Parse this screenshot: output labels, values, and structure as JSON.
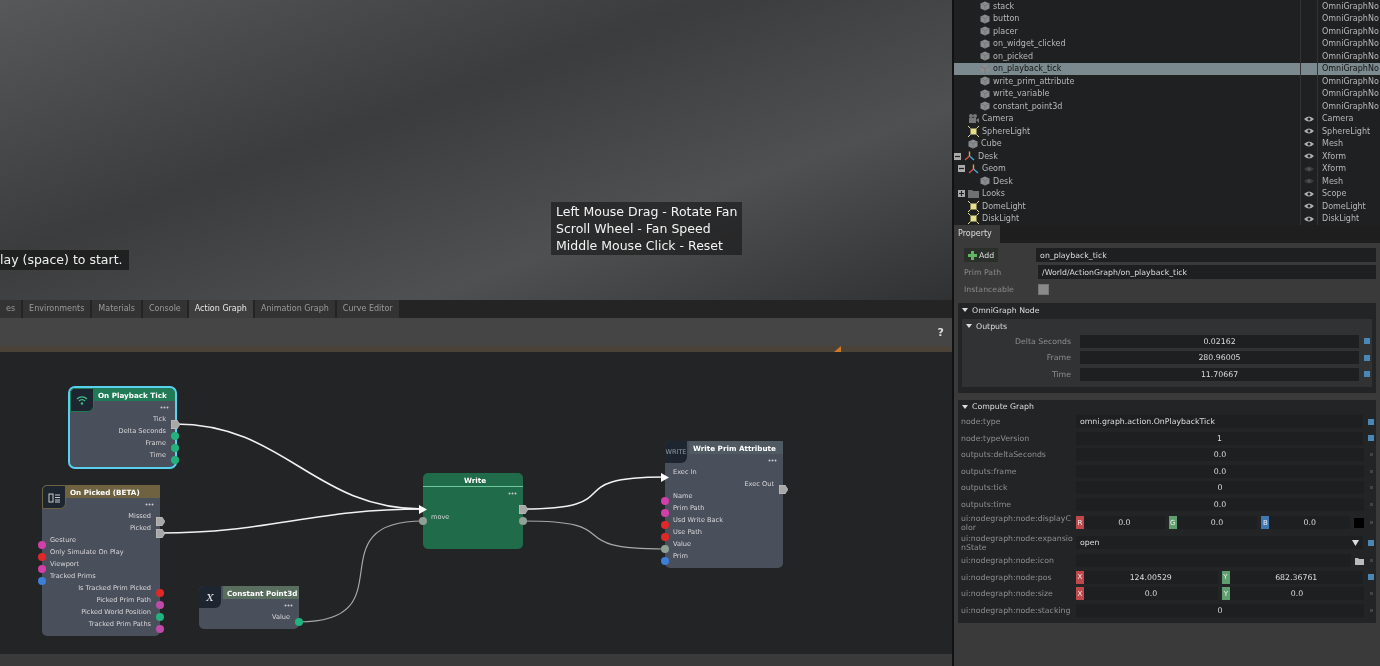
{
  "viewport": {
    "hint": "lay (space) to start.",
    "help": [
      "Left Mouse Drag - Rotate Fan",
      "Scroll Wheel - Fan Speed",
      "Middle Mouse Click - Reset"
    ]
  },
  "tabs": [
    {
      "label": "es",
      "selected": false
    },
    {
      "label": "Environments",
      "selected": false
    },
    {
      "label": "Materials",
      "selected": false
    },
    {
      "label": "Console",
      "selected": false
    },
    {
      "label": "Action Graph",
      "selected": true
    },
    {
      "label": "Animation Graph",
      "selected": false
    },
    {
      "label": "Curve Editor",
      "selected": false
    }
  ],
  "graph": {
    "help": "?",
    "nodes": [
      {
        "title": "On Playback Tick",
        "kind": "event",
        "color": "#1f7a55",
        "selected": true,
        "rows": [
          {
            "out": {
              "label": "Tick",
              "kind": "exec"
            }
          },
          {
            "out": {
              "label": "Delta Seconds",
              "kind": "data",
              "color": "#22b27e"
            }
          },
          {
            "out": {
              "label": "Frame",
              "kind": "data",
              "color": "#22b27e"
            }
          },
          {
            "out": {
              "label": "Time",
              "kind": "data",
              "color": "#22b27e"
            }
          }
        ]
      },
      {
        "title": "On Picked (BETA)",
        "kind": "picker",
        "color": "#6e6240",
        "selected": false,
        "rows": [
          {
            "out": {
              "label": "Missed",
              "kind": "exec"
            }
          },
          {
            "out": {
              "label": "Picked",
              "kind": "exec"
            }
          },
          {
            "in": {
              "label": "Gesture",
              "kind": "data",
              "color": "#d23fa8"
            }
          },
          {
            "in": {
              "label": "Only Simulate On Play",
              "kind": "data",
              "color": "#e02828"
            }
          },
          {
            "in": {
              "label": "Viewport",
              "kind": "data",
              "color": "#d23fa8"
            }
          },
          {
            "in": {
              "label": "Tracked Prims",
              "kind": "data",
              "color": "#3d7fd6"
            }
          },
          {
            "out": {
              "label": "Is Tracked Prim Picked",
              "kind": "data",
              "color": "#e02828"
            }
          },
          {
            "out": {
              "label": "Picked Prim Path",
              "kind": "data",
              "color": "#c04aa8"
            }
          },
          {
            "out": {
              "label": "Picked World Position",
              "kind": "data",
              "color": "#22b27e"
            }
          },
          {
            "out": {
              "label": "Tracked Prim Paths",
              "kind": "data",
              "color": "#c04aa8"
            }
          }
        ]
      },
      {
        "title": "Constant Point3d",
        "kind": "constant",
        "icon_text": "X",
        "color": "#5a6e60",
        "selected": false,
        "rows": [
          {
            "out": {
              "label": "Value",
              "kind": "data",
              "color": "#22b27e"
            }
          }
        ]
      },
      {
        "title": "Write",
        "kind": "compound",
        "color": "#1f6b4a",
        "selected": false,
        "rows": [
          {
            "in": {
              "kind": "exec"
            },
            "out": {
              "kind": "exec"
            }
          },
          {
            "in": {
              "label": "move",
              "kind": "data",
              "color": "#8fa095"
            },
            "out": {
              "kind": "data",
              "color": "#8fa095"
            }
          }
        ]
      },
      {
        "title": "Write Prim Attribute",
        "kind": "action",
        "icon_text": "WRITE",
        "color": "#4f5a62",
        "selected": false,
        "rows": [
          {
            "in": {
              "label": "Exec In",
              "kind": "exec"
            }
          },
          {
            "out": {
              "label": "Exec Out",
              "kind": "exec"
            }
          },
          {
            "in": {
              "label": "Name",
              "kind": "data",
              "color": "#d23fa8"
            }
          },
          {
            "in": {
              "label": "Prim Path",
              "kind": "data",
              "color": "#d23fa8"
            }
          },
          {
            "in": {
              "label": "Usd Write Back",
              "kind": "data",
              "color": "#e02828"
            }
          },
          {
            "in": {
              "label": "Use Path",
              "kind": "data",
              "color": "#e02828"
            }
          },
          {
            "in": {
              "label": "Value",
              "kind": "data",
              "color": "#8fa095"
            }
          },
          {
            "in": {
              "label": "Prim",
              "kind": "data",
              "color": "#3d7fd6"
            }
          }
        ]
      }
    ]
  },
  "stage": {
    "rows": [
      {
        "children": [
          {
            "children": [
              {
                "name": "stack",
                "type": "OmniGraphNo",
                "kind": "node",
                "selected": false
              },
              {
                "name": "button",
                "type": "OmniGraphNo",
                "kind": "node",
                "selected": false
              },
              {
                "name": "placer",
                "type": "OmniGraphNo",
                "kind": "node",
                "selected": false
              },
              {
                "name": "on_widget_clicked",
                "type": "OmniGraphNo",
                "kind": "node",
                "selected": false
              },
              {
                "name": "on_picked",
                "type": "OmniGraphNo",
                "kind": "node",
                "selected": false
              },
              {
                "name": "on_playback_tick",
                "type": "OmniGraphNo",
                "kind": "node",
                "selected": true
              },
              {
                "name": "write_prim_attribute",
                "type": "OmniGraphNo",
                "kind": "node",
                "selected": false
              },
              {
                "name": "write_variable",
                "type": "OmniGraphNo",
                "kind": "node",
                "selected": false
              },
              {
                "name": "constant_point3d",
                "type": "OmniGraphNo",
                "kind": "node",
                "selected": false
              }
            ]
          },
          {
            "name": "Camera",
            "type": "Camera",
            "kind": "camera",
            "visible": true,
            "selected": false
          },
          {
            "name": "SphereLight",
            "type": "SphereLight",
            "kind": "light",
            "visible": true,
            "selected": false
          },
          {
            "name": "Cube",
            "type": "Mesh",
            "kind": "node",
            "visible": true,
            "selected": false
          }
        ]
      },
      {
        "name": "Desk",
        "type": "Xform",
        "kind": "xform",
        "visible": true,
        "expanded": true,
        "selected": false,
        "children": [
          {
            "name": "Geom",
            "type": "Xform",
            "kind": "xform",
            "visible": false,
            "expanded": true,
            "selected": false,
            "children": [
              {
                "name": "Desk",
                "type": "Mesh",
                "kind": "node",
                "visible": false,
                "selected": false
              }
            ]
          },
          {
            "name": "Looks",
            "type": "Scope",
            "kind": "folder",
            "visible": true,
            "expanded": false,
            "selected": false
          },
          {
            "name": "DomeLight",
            "type": "DomeLight",
            "kind": "light",
            "visible": true,
            "selected": false
          },
          {
            "name": "DiskLight",
            "type": "DiskLight",
            "kind": "light",
            "visible": true,
            "selected": false
          }
        ]
      }
    ]
  },
  "property": {
    "tab": "Property",
    "add": "Add",
    "name": "on_playback_tick",
    "prim_path_label": "Prim Path",
    "prim_path": "/World/ActionGraph/on_playback_tick",
    "instanceable_label": "Instanceable",
    "instanceable": false,
    "sections": [
      {
        "title": "OmniGraph Node",
        "expanded": true,
        "groups": [
          {
            "title": "Outputs",
            "expanded": true,
            "rows": [
              {
                "kind": "number",
                "label": "Delta Seconds",
                "value": "0.02162",
                "authored": true
              },
              {
                "kind": "number",
                "label": "Frame",
                "value": "280.96005",
                "authored": true
              },
              {
                "kind": "number",
                "label": "Time",
                "value": "11.70667",
                "authored": true
              }
            ]
          }
        ]
      },
      {
        "title": "Compute Graph",
        "expanded": true,
        "rows": [
          {
            "kind": "text",
            "label": "node:type",
            "value": "omni.graph.action.OnPlaybackTick",
            "authored": true
          },
          {
            "kind": "number",
            "label": "node:typeVersion",
            "value": "1",
            "authored": true
          },
          {
            "kind": "number",
            "label": "outputs:deltaSeconds",
            "value": "0.0",
            "authored": false
          },
          {
            "kind": "number",
            "label": "outputs:frame",
            "value": "0.0",
            "authored": false
          },
          {
            "kind": "number",
            "label": "outputs:tick",
            "value": "0",
            "authored": false
          },
          {
            "kind": "number",
            "label": "outputs:time",
            "value": "0.0",
            "authored": false
          },
          {
            "kind": "vector",
            "label": "ui:nodegraph:node:displayColor",
            "authored": false,
            "fields": [
              {
                "axis": "R",
                "value": "0.0",
                "color": "#c0474c"
              },
              {
                "axis": "G",
                "value": "0.0",
                "color": "#5f9e6e"
              },
              {
                "axis": "B",
                "value": "0.0",
                "color": "#3f78b0"
              }
            ]
          },
          {
            "kind": "dropdown",
            "label": "ui:nodegraph:node:expansionState",
            "value": "open",
            "authored": true
          },
          {
            "kind": "file",
            "label": "ui:nodegraph:node:icon",
            "authored": false
          },
          {
            "kind": "vector",
            "label": "ui:nodegraph:node:pos",
            "authored": true,
            "fields": [
              {
                "axis": "X",
                "value": "124.00529",
                "color": "#c0474c"
              },
              {
                "axis": "Y",
                "value": "682.36761",
                "color": "#5f9e6e"
              }
            ]
          },
          {
            "kind": "vector",
            "label": "ui:nodegraph:node:size",
            "authored": false,
            "fields": [
              {
                "axis": "X",
                "value": "0.0",
                "color": "#c0474c"
              },
              {
                "axis": "Y",
                "value": "0.0",
                "color": "#5f9e6e"
              }
            ]
          },
          {
            "kind": "number",
            "label": "ui:nodegraph:node:stacking",
            "value": "0",
            "authored": false
          }
        ]
      }
    ]
  }
}
